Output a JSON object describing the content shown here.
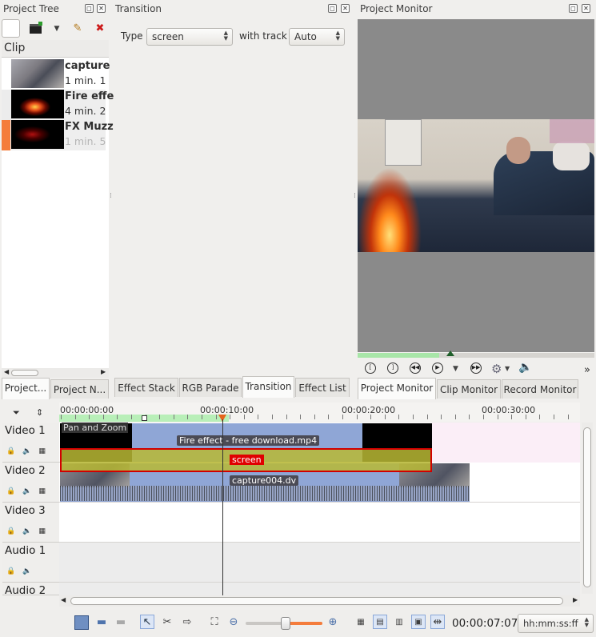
{
  "project_tree": {
    "title": "Project Tree",
    "column_header": "Clip",
    "clips": [
      {
        "title": "capture",
        "duration": "1 min. 1"
      },
      {
        "title": "Fire effe",
        "duration": "4 min. 2"
      },
      {
        "title": "FX Muzz",
        "duration": "1 min. 5"
      }
    ]
  },
  "transition_panel": {
    "title": "Transition",
    "type_label": "Type",
    "type_value": "screen",
    "with_track_label": "with track",
    "with_track_value": "Auto"
  },
  "project_monitor": {
    "title": "Project Monitor",
    "more_label": "»"
  },
  "tabs_left": [
    {
      "label": "Project..."
    },
    {
      "label": "Project N..."
    }
  ],
  "tabs_middle": [
    {
      "label": "Effect Stack"
    },
    {
      "label": "RGB Parade"
    },
    {
      "label": "Transition"
    },
    {
      "label": "Effect List"
    }
  ],
  "tabs_right": [
    {
      "label": "Project Monitor"
    },
    {
      "label": "Clip Monitor"
    },
    {
      "label": "Record Monitor"
    }
  ],
  "timeline": {
    "ruler": [
      "00:00:00:00",
      "00:00:10:00",
      "00:00:20:00",
      "00:00:30:00"
    ],
    "tracks": [
      {
        "name": "Video 1"
      },
      {
        "name": "Video 2"
      },
      {
        "name": "Video 3"
      },
      {
        "name": "Audio 1"
      },
      {
        "name": "Audio 2"
      }
    ],
    "clips": {
      "pan_zoom": "Pan and Zoom",
      "fire": "Fire effect - free download.mp4",
      "transition": "screen",
      "capture": "capture004.dv"
    }
  },
  "status": {
    "timecode": "00:00:07:07",
    "format": "hh:mm:ss:ff",
    "zoom_fraction": 0.52
  },
  "colors": {
    "clip_blue": "#8fa6d6",
    "transition_fill": "#b8b834",
    "transition_border": "#d10000",
    "accent_orange": "#f47c3c"
  }
}
